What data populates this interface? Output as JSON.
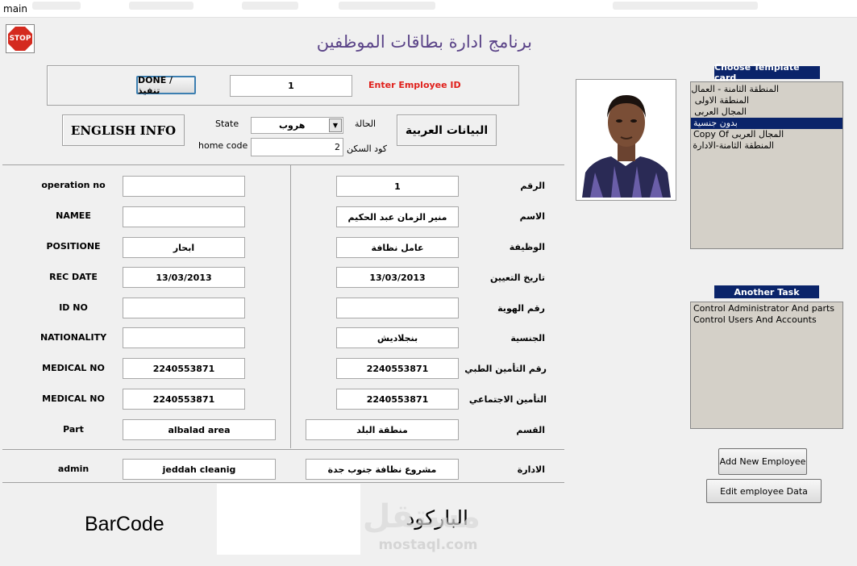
{
  "window": {
    "title": "main"
  },
  "header": {
    "title": "برنامج ادارة بطاقات الموظفين"
  },
  "employee_search": {
    "done_label": "DONE / تنفيذ",
    "id_value": "1",
    "id_label": "Enter Employee ID"
  },
  "info_buttons": {
    "english": "ENGLISH INFO",
    "arabic": "البيانات العربية"
  },
  "state": {
    "label_en": "State",
    "label_ar": "الحالة",
    "value": "هروب",
    "code_label_en": "home code",
    "code_label_ar": "كود السكن",
    "code_value": "2"
  },
  "english_fields": [
    {
      "label": "operation no",
      "value": ""
    },
    {
      "label": "NAMEE",
      "value": ""
    },
    {
      "label": "POSITIONE",
      "value": "ابحار"
    },
    {
      "label": "REC DATE",
      "value": "13/03/2013"
    },
    {
      "label": "ID NO",
      "value": ""
    },
    {
      "label": "NATIONALITY",
      "value": ""
    },
    {
      "label": "MEDICAL NO",
      "value": "2240553871"
    },
    {
      "label": "MEDICAL NO",
      "value": "2240553871"
    },
    {
      "label": "Part",
      "value": "albalad area"
    },
    {
      "label": "admin",
      "value": "jeddah cleanig"
    }
  ],
  "arabic_fields": [
    {
      "label": "الرقم",
      "value": "1"
    },
    {
      "label": "الاسم",
      "value": "منير الزمان عبد الحكيم"
    },
    {
      "label": "الوظيفة",
      "value": "عامل نظافة"
    },
    {
      "label": "تاريخ التعيين",
      "value": "13/03/2013"
    },
    {
      "label": "رقم الهوية",
      "value": ""
    },
    {
      "label": "الجنسية",
      "value": "بنجلاديش"
    },
    {
      "label": "رقم التأمين الطبي",
      "value": "2240553871"
    },
    {
      "label": "التأمين الاجتماعي",
      "value": "2240553871"
    },
    {
      "label": "القسم",
      "value": "منطقة البلد"
    },
    {
      "label": "الادارة",
      "value": "مشروع نظافة جنوب جدة"
    }
  ],
  "barcode": {
    "label_en": "BarCode",
    "label_ar": "الباركود"
  },
  "template_card": {
    "header": "Choose Template card",
    "items": [
      "المنطقة الثامنة - العمال",
      "المنطقة الاولى",
      "المجال العربى",
      "بدون جنسية",
      "Copy Of المجال العربى",
      "المنطقة الثامنة-الادارة"
    ],
    "selected_index": 3
  },
  "another_task": {
    "header": "Another Task",
    "items": [
      "Control Administrator And parts",
      "Control Users And Accounts"
    ]
  },
  "actions": {
    "add": "Add New Employee",
    "edit": "Edit employee Data"
  },
  "watermark": {
    "brand": "مستقل",
    "site": "mostaql.com"
  },
  "colors": {
    "title": "#5b4488",
    "list_header": "#0a246a",
    "list_bg": "#d4d0c8",
    "emp_id_label": "#e0201b"
  }
}
